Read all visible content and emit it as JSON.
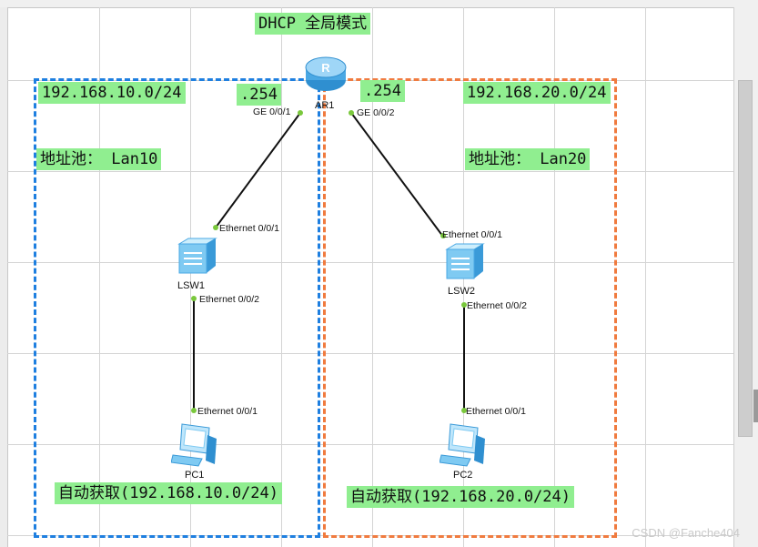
{
  "diagram": {
    "title": "DHCP 全局模式",
    "router": {
      "name": "AR1",
      "icon": "router-icon",
      "port_left": "GE 0/0/1",
      "port_right": "GE 0/0/2"
    },
    "left": {
      "subnet": "192.168.10.0/24",
      "gateway": ".254",
      "pool": "地址池： Lan10",
      "switch": {
        "name": "LSW1",
        "icon": "switch-icon",
        "port_up": "Ethernet 0/0/1",
        "port_down": "Ethernet 0/0/2"
      },
      "pc": {
        "name": "PC1",
        "icon": "pc-icon",
        "port": "Ethernet 0/0/1"
      },
      "dhcp_note": "自动获取(192.168.10.0/24)",
      "zone_color": "#1e7fe0"
    },
    "right": {
      "subnet": "192.168.20.0/24",
      "gateway": ".254",
      "pool": "地址池： Lan20",
      "switch": {
        "name": "LSW2",
        "icon": "switch-icon",
        "port_up": "Ethernet 0/0/1",
        "port_down": "Ethernet 0/0/2"
      },
      "pc": {
        "name": "PC2",
        "icon": "pc-icon",
        "port": "Ethernet 0/0/1"
      },
      "dhcp_note": "自动获取(192.168.20.0/24)",
      "zone_color": "#f07b3f"
    },
    "label_bg": "#90ee90",
    "watermark": "CSDN @Fanche404"
  }
}
